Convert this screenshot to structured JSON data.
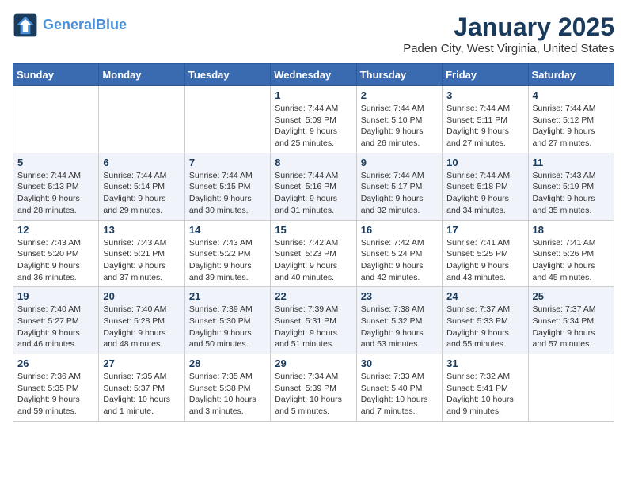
{
  "header": {
    "logo_line1": "General",
    "logo_line2": "Blue",
    "title": "January 2025",
    "subtitle": "Paden City, West Virginia, United States"
  },
  "weekdays": [
    "Sunday",
    "Monday",
    "Tuesday",
    "Wednesday",
    "Thursday",
    "Friday",
    "Saturday"
  ],
  "weeks": [
    [
      {
        "day": "",
        "info": ""
      },
      {
        "day": "",
        "info": ""
      },
      {
        "day": "",
        "info": ""
      },
      {
        "day": "1",
        "info": "Sunrise: 7:44 AM\nSunset: 5:09 PM\nDaylight: 9 hours and 25 minutes."
      },
      {
        "day": "2",
        "info": "Sunrise: 7:44 AM\nSunset: 5:10 PM\nDaylight: 9 hours and 26 minutes."
      },
      {
        "day": "3",
        "info": "Sunrise: 7:44 AM\nSunset: 5:11 PM\nDaylight: 9 hours and 27 minutes."
      },
      {
        "day": "4",
        "info": "Sunrise: 7:44 AM\nSunset: 5:12 PM\nDaylight: 9 hours and 27 minutes."
      }
    ],
    [
      {
        "day": "5",
        "info": "Sunrise: 7:44 AM\nSunset: 5:13 PM\nDaylight: 9 hours and 28 minutes."
      },
      {
        "day": "6",
        "info": "Sunrise: 7:44 AM\nSunset: 5:14 PM\nDaylight: 9 hours and 29 minutes."
      },
      {
        "day": "7",
        "info": "Sunrise: 7:44 AM\nSunset: 5:15 PM\nDaylight: 9 hours and 30 minutes."
      },
      {
        "day": "8",
        "info": "Sunrise: 7:44 AM\nSunset: 5:16 PM\nDaylight: 9 hours and 31 minutes."
      },
      {
        "day": "9",
        "info": "Sunrise: 7:44 AM\nSunset: 5:17 PM\nDaylight: 9 hours and 32 minutes."
      },
      {
        "day": "10",
        "info": "Sunrise: 7:44 AM\nSunset: 5:18 PM\nDaylight: 9 hours and 34 minutes."
      },
      {
        "day": "11",
        "info": "Sunrise: 7:43 AM\nSunset: 5:19 PM\nDaylight: 9 hours and 35 minutes."
      }
    ],
    [
      {
        "day": "12",
        "info": "Sunrise: 7:43 AM\nSunset: 5:20 PM\nDaylight: 9 hours and 36 minutes."
      },
      {
        "day": "13",
        "info": "Sunrise: 7:43 AM\nSunset: 5:21 PM\nDaylight: 9 hours and 37 minutes."
      },
      {
        "day": "14",
        "info": "Sunrise: 7:43 AM\nSunset: 5:22 PM\nDaylight: 9 hours and 39 minutes."
      },
      {
        "day": "15",
        "info": "Sunrise: 7:42 AM\nSunset: 5:23 PM\nDaylight: 9 hours and 40 minutes."
      },
      {
        "day": "16",
        "info": "Sunrise: 7:42 AM\nSunset: 5:24 PM\nDaylight: 9 hours and 42 minutes."
      },
      {
        "day": "17",
        "info": "Sunrise: 7:41 AM\nSunset: 5:25 PM\nDaylight: 9 hours and 43 minutes."
      },
      {
        "day": "18",
        "info": "Sunrise: 7:41 AM\nSunset: 5:26 PM\nDaylight: 9 hours and 45 minutes."
      }
    ],
    [
      {
        "day": "19",
        "info": "Sunrise: 7:40 AM\nSunset: 5:27 PM\nDaylight: 9 hours and 46 minutes."
      },
      {
        "day": "20",
        "info": "Sunrise: 7:40 AM\nSunset: 5:28 PM\nDaylight: 9 hours and 48 minutes."
      },
      {
        "day": "21",
        "info": "Sunrise: 7:39 AM\nSunset: 5:30 PM\nDaylight: 9 hours and 50 minutes."
      },
      {
        "day": "22",
        "info": "Sunrise: 7:39 AM\nSunset: 5:31 PM\nDaylight: 9 hours and 51 minutes."
      },
      {
        "day": "23",
        "info": "Sunrise: 7:38 AM\nSunset: 5:32 PM\nDaylight: 9 hours and 53 minutes."
      },
      {
        "day": "24",
        "info": "Sunrise: 7:37 AM\nSunset: 5:33 PM\nDaylight: 9 hours and 55 minutes."
      },
      {
        "day": "25",
        "info": "Sunrise: 7:37 AM\nSunset: 5:34 PM\nDaylight: 9 hours and 57 minutes."
      }
    ],
    [
      {
        "day": "26",
        "info": "Sunrise: 7:36 AM\nSunset: 5:35 PM\nDaylight: 9 hours and 59 minutes."
      },
      {
        "day": "27",
        "info": "Sunrise: 7:35 AM\nSunset: 5:37 PM\nDaylight: 10 hours and 1 minute."
      },
      {
        "day": "28",
        "info": "Sunrise: 7:35 AM\nSunset: 5:38 PM\nDaylight: 10 hours and 3 minutes."
      },
      {
        "day": "29",
        "info": "Sunrise: 7:34 AM\nSunset: 5:39 PM\nDaylight: 10 hours and 5 minutes."
      },
      {
        "day": "30",
        "info": "Sunrise: 7:33 AM\nSunset: 5:40 PM\nDaylight: 10 hours and 7 minutes."
      },
      {
        "day": "31",
        "info": "Sunrise: 7:32 AM\nSunset: 5:41 PM\nDaylight: 10 hours and 9 minutes."
      },
      {
        "day": "",
        "info": ""
      }
    ]
  ]
}
